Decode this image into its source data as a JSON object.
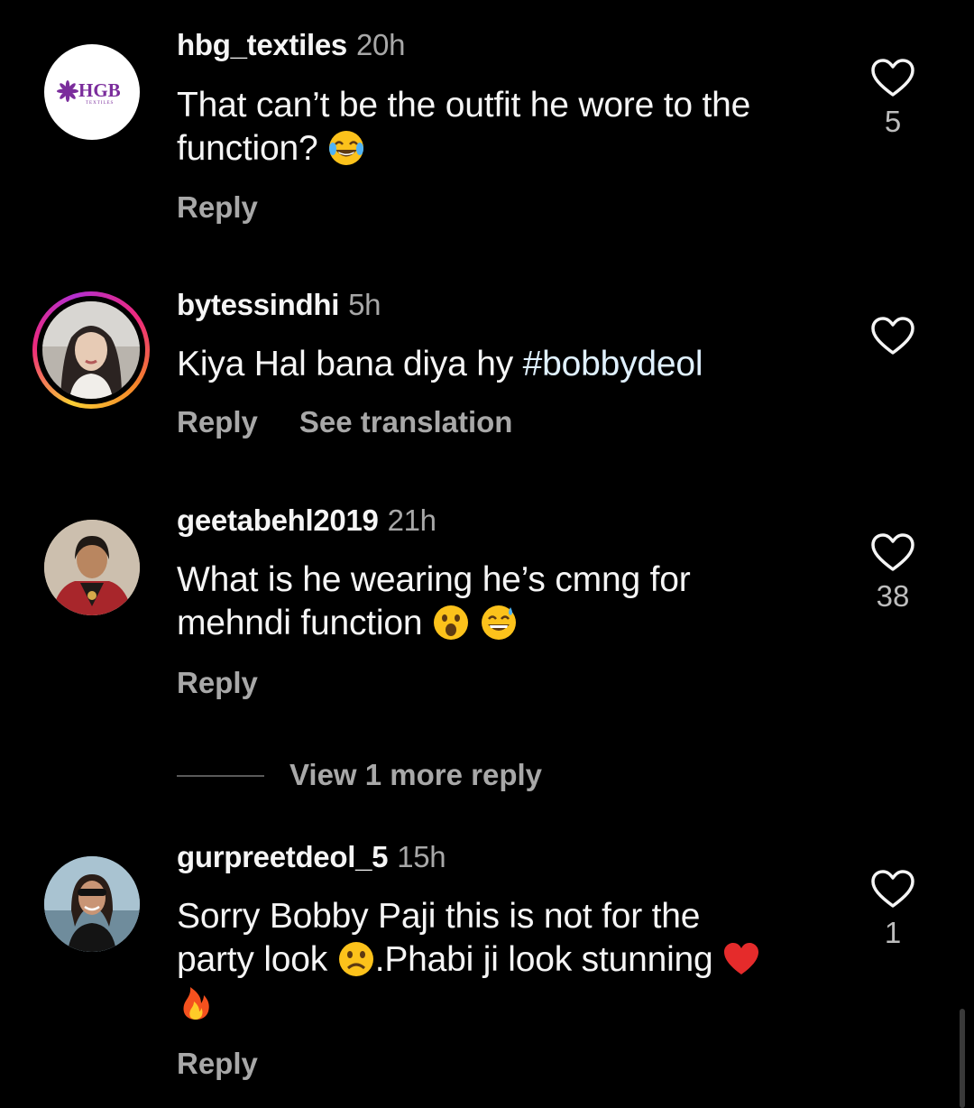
{
  "comments": [
    {
      "username": "hbg_textiles",
      "time": "20h",
      "text_line1": "That can’t be the outfit he wore to the",
      "text_line2": "function? ",
      "emojis": [
        "face-with-tears-of-joy"
      ],
      "reply_label": "Reply",
      "like_count": "5",
      "avatar_logo_text": "HGB",
      "avatar_logo_sub": "TEXTILES"
    },
    {
      "username": "bytessindhi",
      "time": "5h",
      "text_line1": "Kiya Hal bana diya hy ",
      "hashtag": "#bobbydeol",
      "reply_label": "Reply",
      "translate_label": "See translation",
      "like_count": ""
    },
    {
      "username": "geetabehl2019",
      "time": "21h",
      "text_line1": "What is he wearing he’s cmng for",
      "text_line2": "mehndi function ",
      "emojis": [
        "face-with-open-mouth",
        "grinning-face-with-sweat"
      ],
      "reply_label": "Reply",
      "like_count": "38",
      "view_more_label": "View 1 more reply"
    },
    {
      "username": "gurpreetdeol_5",
      "time": "15h",
      "text_line1": "Sorry Bobby Paji this is not for the",
      "text_line2a": "party look ",
      "text_line2b": ".Phabi ji look stunning ",
      "emojis": [
        "frowning-face",
        "red-heart",
        "fire"
      ],
      "reply_label": "Reply",
      "like_count": "1"
    }
  ],
  "colors": {
    "background": "#000000",
    "text": "#f5f5f5",
    "secondary": "#a8a8a8",
    "hashtag": "#e0f1ff",
    "hgb_purple": "#7b2d9c"
  }
}
